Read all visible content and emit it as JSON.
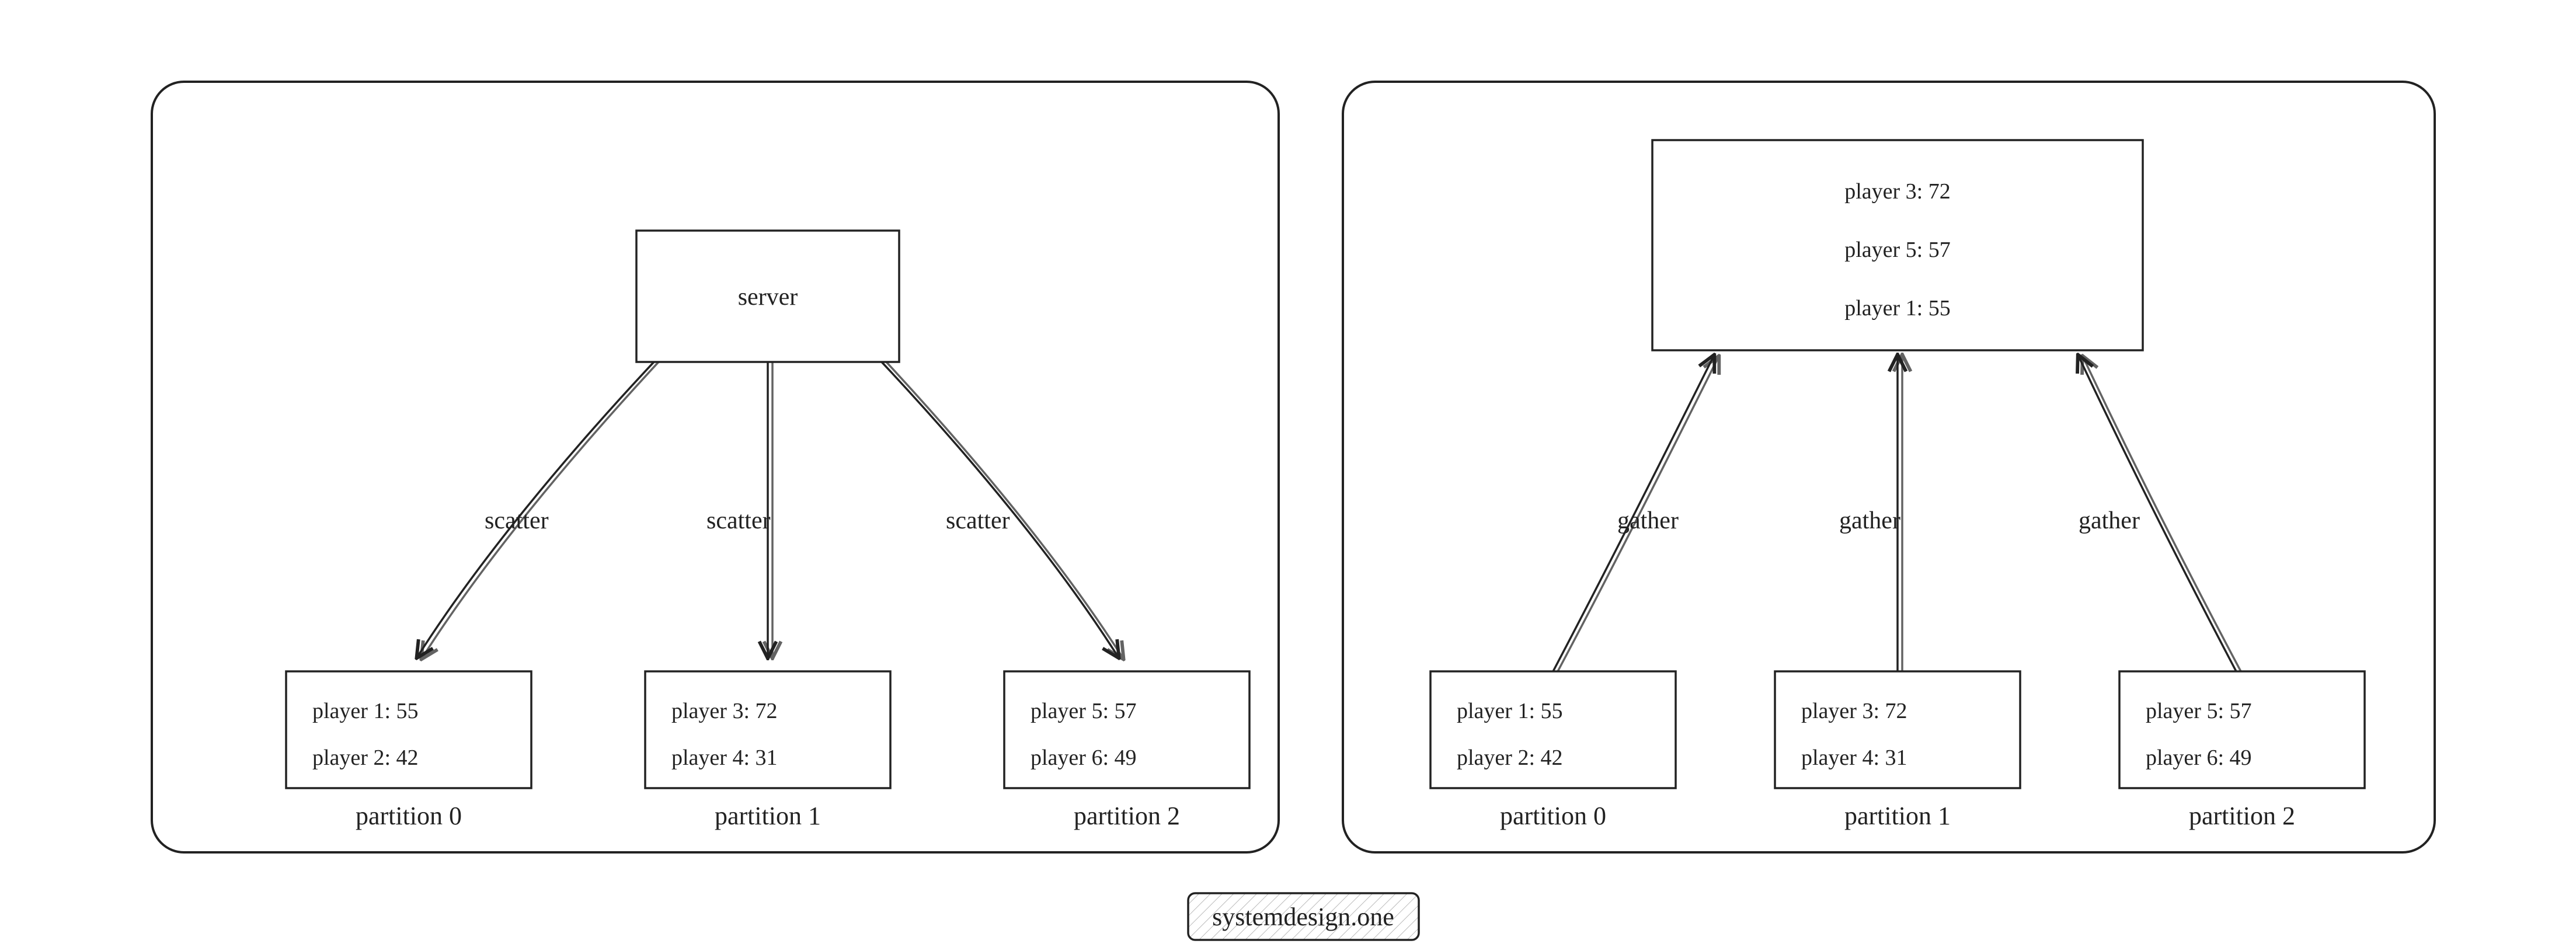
{
  "watermark": "systemdesign.one",
  "left": {
    "server_label": "server",
    "arrows": {
      "a0": "scatter",
      "a1": "scatter",
      "a2": "scatter"
    },
    "partitions": [
      {
        "caption": "partition 0",
        "lines": [
          "player 1: 55",
          "player 2: 42"
        ]
      },
      {
        "caption": "partition 1",
        "lines": [
          "player 3: 72",
          "player 4: 31"
        ]
      },
      {
        "caption": "partition 2",
        "lines": [
          "player 5: 57",
          "player 6: 49"
        ]
      }
    ]
  },
  "right": {
    "result_lines": [
      "player 3: 72",
      "player 5: 57",
      "player 1: 55"
    ],
    "arrows": {
      "a0": "gather",
      "a1": "gather",
      "a2": "gather"
    },
    "partitions": [
      {
        "caption": "partition 0",
        "lines": [
          "player 1: 55",
          "player 2: 42"
        ]
      },
      {
        "caption": "partition 1",
        "lines": [
          "player 3: 72",
          "player 4: 31"
        ]
      },
      {
        "caption": "partition 2",
        "lines": [
          "player 5: 57",
          "player 6: 49"
        ]
      }
    ]
  }
}
